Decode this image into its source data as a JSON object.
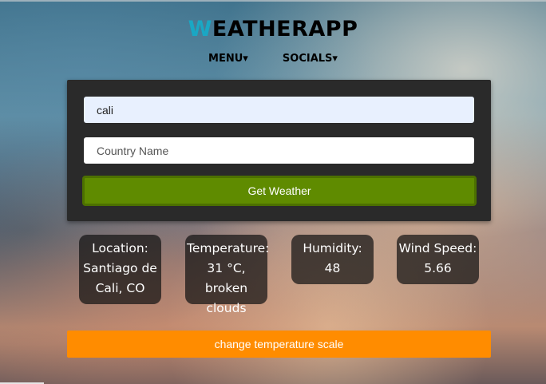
{
  "app": {
    "logo_accent": "W",
    "logo_rest": "EATHERAPP"
  },
  "nav": {
    "menu_label": "MENU▾",
    "socials_label": "SOCIALS▾"
  },
  "form": {
    "city_value": "cali",
    "country_placeholder": "Country Name",
    "get_weather_label": "Get Weather"
  },
  "results": {
    "location": "Location: Santiago de Cali, CO",
    "temperature": "Temperature: 31 °C, broken clouds",
    "humidity": "Humidity: 48",
    "wind": "Wind Speed: 5.66"
  },
  "actions": {
    "change_scale_label": "change temperature scale"
  },
  "colors": {
    "accent": "#1aa7c4",
    "get_weather_button": "#5f8b00",
    "scale_button": "#ff8c00",
    "panel": "#2a2a2a"
  }
}
